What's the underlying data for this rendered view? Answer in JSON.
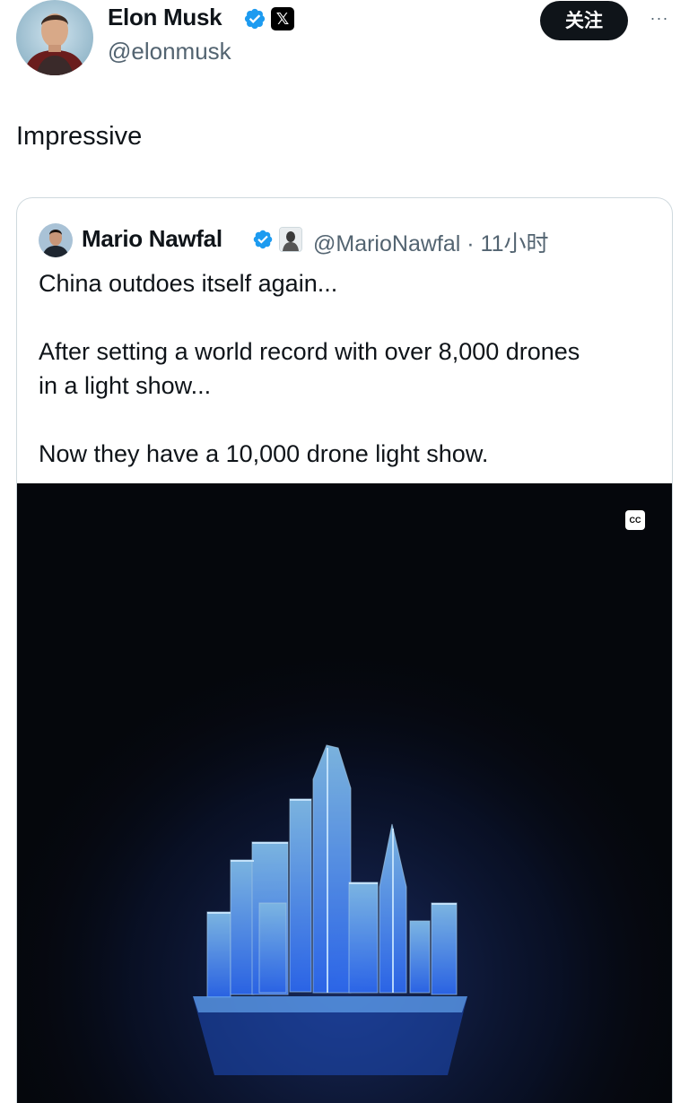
{
  "author": {
    "name": "Elon Musk",
    "handle": "@elonmusk",
    "affiliate_glyph": "𝕏"
  },
  "actions": {
    "follow_label": "关注",
    "more_label": "···"
  },
  "post": {
    "text": "Impressive"
  },
  "quoted": {
    "name": "Mario Nawfal",
    "meta": "@MarioNawfal · 11小时",
    "lines": [
      "China outdoes itself again...",
      "",
      "After setting a world record with over 8,000 drones",
      "in a light show...",
      "",
      "Now they have a 10,000 drone light show."
    ],
    "media": {
      "cc_label": "CC"
    }
  },
  "colors": {
    "verified": "#1d9bf0",
    "follow_bg": "#0f1419",
    "muted": "#536471",
    "border": "#cfd9de",
    "drone_glow": "#4fa3ff"
  }
}
